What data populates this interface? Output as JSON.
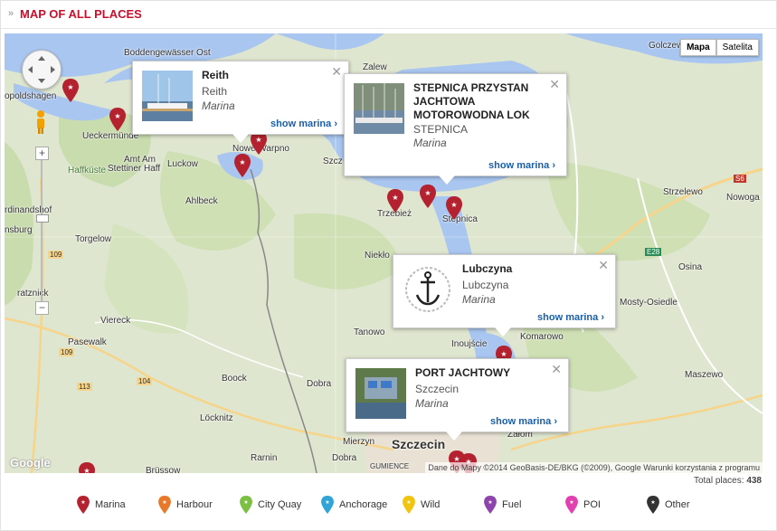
{
  "header": {
    "title": "MAP OF ALL PLACES"
  },
  "map_type": {
    "map": "Mapa",
    "satellite": "Satelita"
  },
  "places": {
    "boddengewasser": "Boddengewässer Ost",
    "zalew": "Zalew",
    "golczewo": "Golczew",
    "leopoldshagen": "opoldshagen",
    "ueckermunde": "Ueckermünde",
    "haffkuste": "Haffküste",
    "amt_am": "Amt Am",
    "stettiner_haff": "Stettiner Haff",
    "luckow": "Luckow",
    "nowe_warpno": "Nowe Warpno",
    "szczecin_lagoon": "Szcz",
    "ahlbeck": "Ahlbeck",
    "ferdinandshof": "rdinandshof",
    "torgelow": "Torgelow",
    "trzebiez": "Trzebież",
    "stepnica": "Stepnica",
    "strzelewo": "Strzelewo",
    "nowogard": "Nowoga",
    "niekloncica": "Niekło",
    "osina": "Osina",
    "mosty": "Mosty-Osiedle",
    "viereck": "Viereck",
    "tanowo": "Tanowo",
    "inoujscie": "Inoujście",
    "komarowo": "Komarowo",
    "pasewalk": "Pasewalk",
    "boock": "Boock",
    "dobra": "Dobra",
    "maszewo": "Maszewo",
    "locknitz": "Löcknitz",
    "mierzyn": "Mierzyn",
    "szczecin": "Szczecin",
    "zalom": "Załom",
    "rarnin": "Rarnin",
    "dobra2": "Dobra",
    "brussow": "Brüssow",
    "gumience": "GUMIENCE",
    "ratznick": "ratznick",
    "insburg": "nsburg"
  },
  "road_labels": {
    "r109a": "109",
    "r109b": "109",
    "r104": "104",
    "r113": "113",
    "s6": "S6",
    "e28": "E28"
  },
  "popups": [
    {
      "title": "Reith",
      "city": "Reith",
      "type": "Marina",
      "link": "show marina ›"
    },
    {
      "title": "STEPNICA PRZYSTAN JACHTOWA MOTOROWODNA LOK",
      "title_lines": [
        "STEPNICA PRZYSTAN",
        "JACHTOWA",
        "MOTOROWODNA LOK"
      ],
      "city": "STEPNICA",
      "type": "Marina",
      "link": "show marina ›"
    },
    {
      "title": "Lubczyna",
      "city": "Lubczyna",
      "type": "Marina",
      "link": "show marina ›"
    },
    {
      "title": "PORT JACHTOWY",
      "city": "Szczecin",
      "type": "Marina",
      "link": "show marina ›"
    }
  ],
  "attribution": "Dane do Mapy ©2014 GeoBasis-DE/BKG (©2009), Google    Warunki korzystania z programu",
  "google_logo": "Google",
  "total": {
    "label": "Total places:",
    "value": "438"
  },
  "legend": [
    {
      "label": "Marina",
      "color": "#b4222f"
    },
    {
      "label": "Harbour",
      "color": "#e8792a"
    },
    {
      "label": "City Quay",
      "color": "#7bc043"
    },
    {
      "label": "Anchorage",
      "color": "#2fa4d6"
    },
    {
      "label": "Wild",
      "color": "#f1c40f"
    },
    {
      "label": "Fuel",
      "color": "#8e44ad"
    },
    {
      "label": "POI",
      "color": "#e040b0"
    },
    {
      "label": "Other",
      "color": "#333333"
    }
  ],
  "colors": {
    "accent": "#c8102e",
    "link": "#1a5fa8",
    "water": "#a9c6f0",
    "land": "#dfe6cf"
  }
}
